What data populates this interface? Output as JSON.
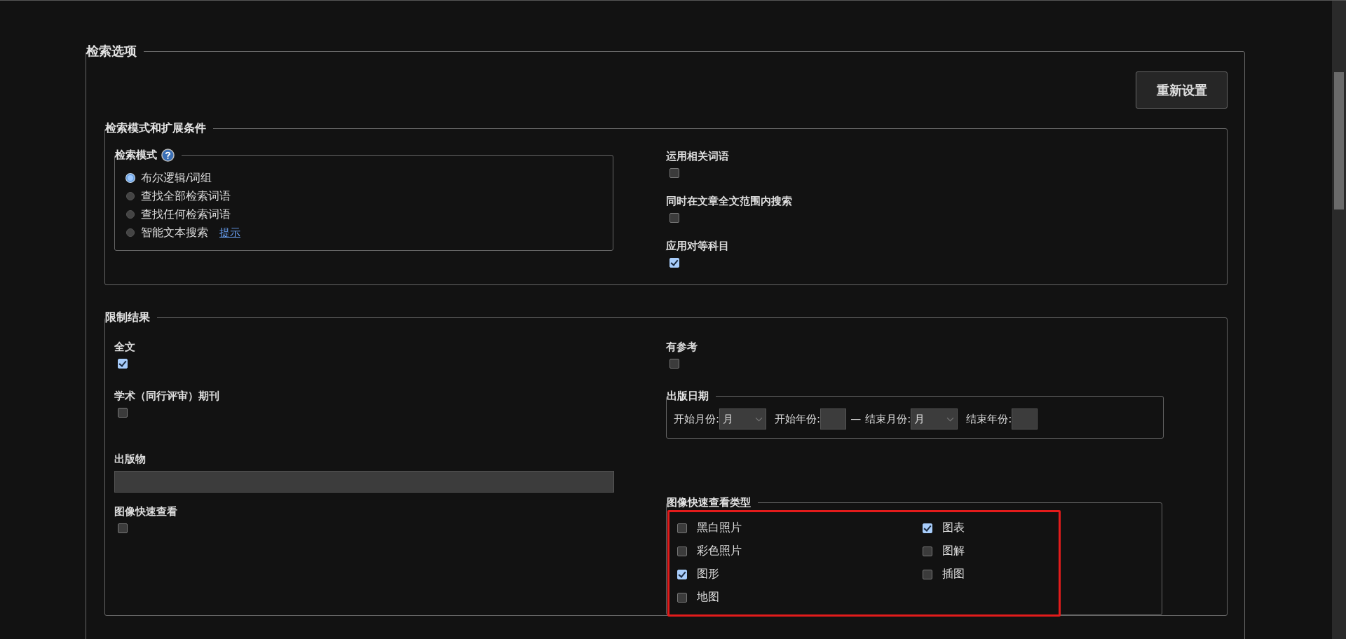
{
  "title": "检索选项",
  "reset_button": "重新设置",
  "mode_section": {
    "title": "检索模式和扩展条件",
    "mode_group": {
      "title": "检索模式",
      "options": [
        {
          "label": "布尔逻辑/词组",
          "selected": true
        },
        {
          "label": "查找全部检索词语",
          "selected": false
        },
        {
          "label": "查找任何检索词语",
          "selected": false
        },
        {
          "label": "智能文本搜索",
          "selected": false,
          "link": "提示"
        }
      ]
    },
    "options": [
      {
        "label": "运用相关词语",
        "checked": false
      },
      {
        "label": "同时在文章全文范围内搜索",
        "checked": false
      },
      {
        "label": "应用对等科目",
        "checked": true
      }
    ]
  },
  "limit_section": {
    "title": "限制结果",
    "left": [
      {
        "kind": "checkbox",
        "label": "全文",
        "checked": true
      },
      {
        "kind": "checkbox",
        "label": "学术（同行评审）期刊",
        "checked": false
      },
      {
        "kind": "field",
        "label": "出版物"
      },
      {
        "kind": "checkbox",
        "label": "图像快速查看",
        "checked": false
      }
    ],
    "references": {
      "label": "有参考",
      "checked": false
    },
    "date": {
      "title": "出版日期",
      "fields": [
        {
          "kind": "select",
          "label": "开始月份:",
          "value": "月"
        },
        {
          "kind": "input",
          "label": "开始年份:"
        },
        {
          "kind": "dash",
          "label": "—"
        },
        {
          "kind": "select",
          "label": "结束月份:",
          "value": "月"
        },
        {
          "kind": "input",
          "label": "结束年份:"
        }
      ]
    },
    "image_types": {
      "title": "图像快速查看类型",
      "highlighted": true,
      "columns": [
        [
          {
            "label": "黑白照片",
            "checked": false
          },
          {
            "label": "彩色照片",
            "checked": false
          },
          {
            "label": "图形",
            "checked": true
          },
          {
            "label": "地图",
            "checked": false
          }
        ],
        [
          {
            "label": "图表",
            "checked": true
          },
          {
            "label": "图解",
            "checked": false
          },
          {
            "label": "插图",
            "checked": false
          }
        ]
      ]
    }
  }
}
